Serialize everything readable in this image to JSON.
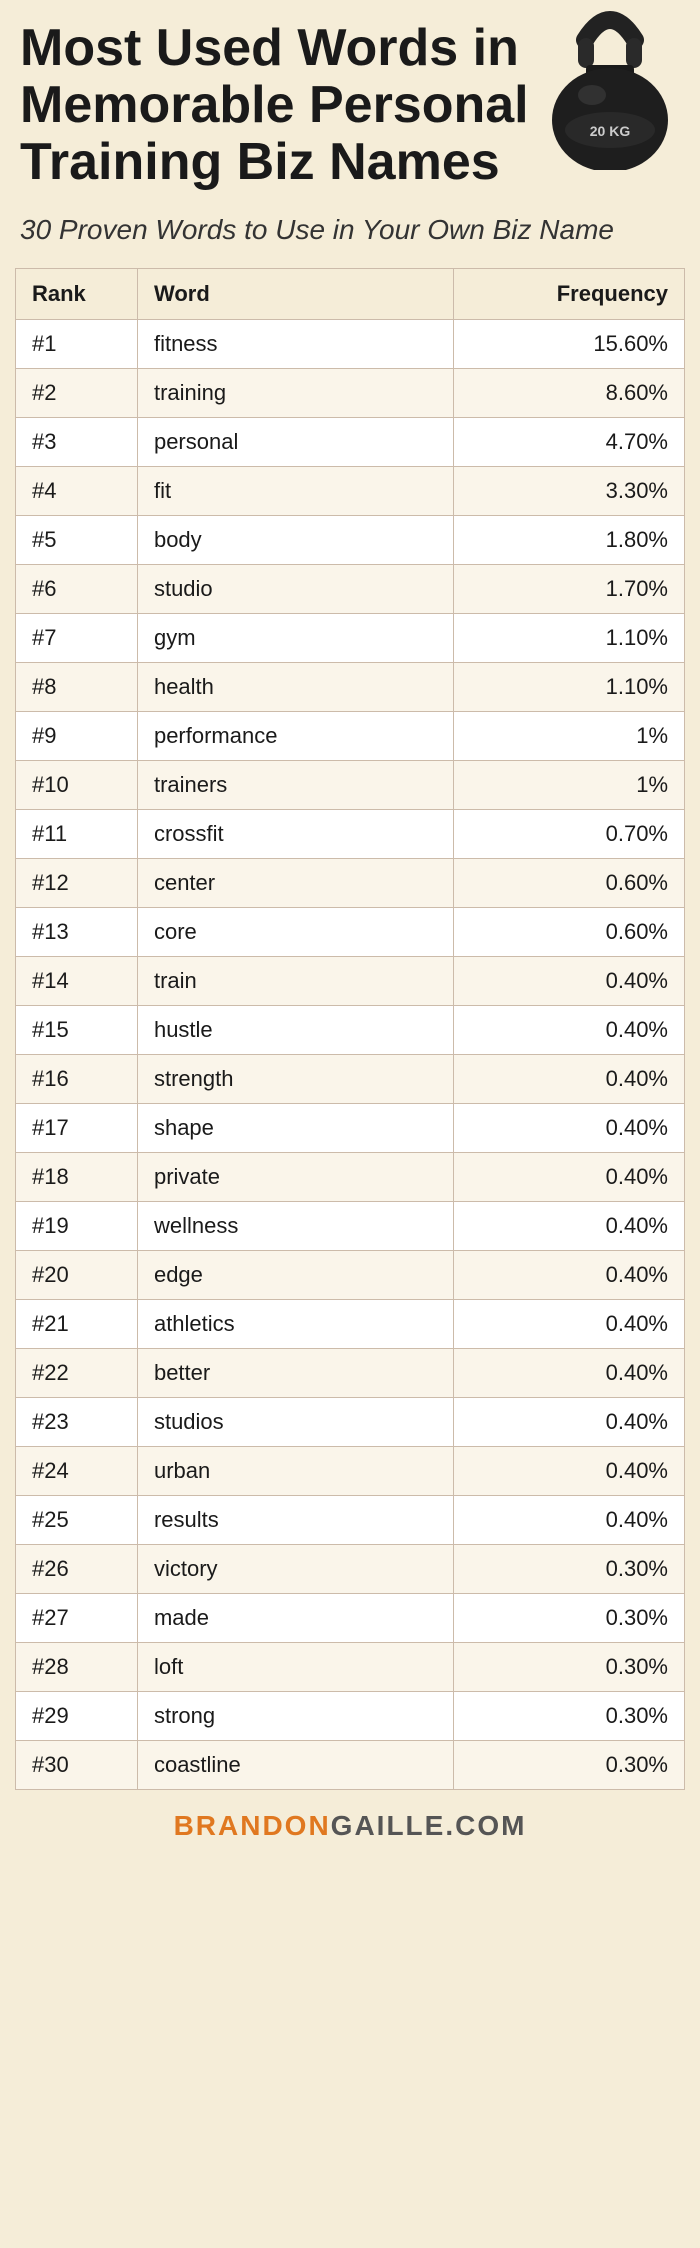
{
  "header": {
    "title": "Most Used Words in Memorable Personal Training Biz Names",
    "subtitle": "30 Proven Words to Use in Your Own Biz Name"
  },
  "table": {
    "columns": [
      "Rank",
      "Word",
      "Frequency"
    ],
    "rows": [
      {
        "rank": "#1",
        "word": "fitness",
        "frequency": "15.60%"
      },
      {
        "rank": "#2",
        "word": "training",
        "frequency": "8.60%"
      },
      {
        "rank": "#3",
        "word": "personal",
        "frequency": "4.70%"
      },
      {
        "rank": "#4",
        "word": "fit",
        "frequency": "3.30%"
      },
      {
        "rank": "#5",
        "word": "body",
        "frequency": "1.80%"
      },
      {
        "rank": "#6",
        "word": "studio",
        "frequency": "1.70%"
      },
      {
        "rank": "#7",
        "word": "gym",
        "frequency": "1.10%"
      },
      {
        "rank": "#8",
        "word": "health",
        "frequency": "1.10%"
      },
      {
        "rank": "#9",
        "word": "performance",
        "frequency": "1%"
      },
      {
        "rank": "#10",
        "word": "trainers",
        "frequency": "1%"
      },
      {
        "rank": "#11",
        "word": "crossfit",
        "frequency": "0.70%"
      },
      {
        "rank": "#12",
        "word": "center",
        "frequency": "0.60%"
      },
      {
        "rank": "#13",
        "word": "core",
        "frequency": "0.60%"
      },
      {
        "rank": "#14",
        "word": "train",
        "frequency": "0.40%"
      },
      {
        "rank": "#15",
        "word": "hustle",
        "frequency": "0.40%"
      },
      {
        "rank": "#16",
        "word": "strength",
        "frequency": "0.40%"
      },
      {
        "rank": "#17",
        "word": "shape",
        "frequency": "0.40%"
      },
      {
        "rank": "#18",
        "word": "private",
        "frequency": "0.40%"
      },
      {
        "rank": "#19",
        "word": "wellness",
        "frequency": "0.40%"
      },
      {
        "rank": "#20",
        "word": "edge",
        "frequency": "0.40%"
      },
      {
        "rank": "#21",
        "word": "athletics",
        "frequency": "0.40%"
      },
      {
        "rank": "#22",
        "word": "better",
        "frequency": "0.40%"
      },
      {
        "rank": "#23",
        "word": "studios",
        "frequency": "0.40%"
      },
      {
        "rank": "#24",
        "word": "urban",
        "frequency": "0.40%"
      },
      {
        "rank": "#25",
        "word": "results",
        "frequency": "0.40%"
      },
      {
        "rank": "#26",
        "word": "victory",
        "frequency": "0.30%"
      },
      {
        "rank": "#27",
        "word": "made",
        "frequency": "0.30%"
      },
      {
        "rank": "#28",
        "word": "loft",
        "frequency": "0.30%"
      },
      {
        "rank": "#29",
        "word": "strong",
        "frequency": "0.30%"
      },
      {
        "rank": "#30",
        "word": "coastline",
        "frequency": "0.30%"
      }
    ]
  },
  "footer": {
    "brandon": "BRANDON",
    "gaille": "GAILLE.COM"
  }
}
